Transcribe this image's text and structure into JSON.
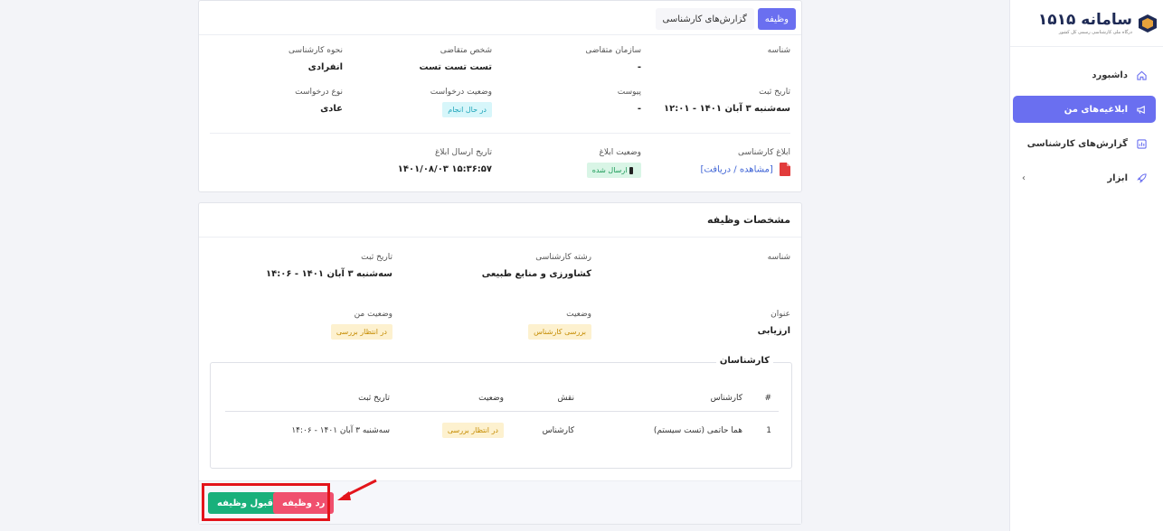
{
  "sidebar": {
    "logo_title": "سامانه ۱۵۱۵",
    "logo_sub": "درگاه ملی کارشناسی رسمی کل کشور",
    "items": [
      {
        "label": "داشبورد"
      },
      {
        "label": "ابلاغیه‌های من"
      },
      {
        "label": "گزارش‌های کارشناسی"
      },
      {
        "label": "ابزار",
        "chevron": "‹"
      }
    ]
  },
  "tabs": [
    {
      "label": "وظیفه"
    },
    {
      "label": "گزارش‌های کارشناسی"
    }
  ],
  "notice": {
    "id_label": "شناسه",
    "org_label": "سازمان متقاضی",
    "org_value": "-",
    "applicant_label": "شخص متقاضی",
    "applicant_value": "تست تست تست",
    "method_label": "نحوه کارشناسی",
    "method_value": "انفرادی",
    "reg_date_label": "تاریخ ثبت",
    "reg_date_value": "سه‌شنبه ۳ آبان ۱۴۰۱ - ۱۲:۰۱",
    "attach_label": "پیوست",
    "attach_value": "-",
    "req_status_label": "وضعیت درخواست",
    "req_status_value": "در حال انجام",
    "req_type_label": "نوع درخواست",
    "req_type_value": "عادی",
    "expert_notice_label": "ابلاغ کارشناسی",
    "expert_notice_link": "[مشاهده / دریافت]",
    "notice_status_label": "وضعیت ابلاغ",
    "notice_status_value": "ارسال شده",
    "send_date_label": "تاریخ ارسال ابلاغ",
    "send_date_value": "۱۴۰۱/۰۸/۰۳ ۱۵:۳۶:۵۷"
  },
  "task": {
    "title": "مشخصات وظیفه",
    "id_label": "شناسه",
    "field_label": "رشته کارشناسی",
    "field_value": "کشاورزی و منابع طبیعی",
    "reg_date_label": "تاریخ ثبت",
    "reg_date_value": "سه‌شنبه ۳ آبان ۱۴۰۱ - ۱۴:۰۶",
    "title_label": "عنوان",
    "title_value": "ارزیابی",
    "status_label": "وضعیت",
    "status_value": "بررسی کارشناس",
    "my_status_label": "وضعیت من",
    "my_status_value": "در انتظار بررسی"
  },
  "experts": {
    "legend": "کارشناسان",
    "headers": {
      "num": "#",
      "expert": "کارشناس",
      "role": "نقش",
      "status": "وضعیت",
      "date": "تاریخ ثبت"
    },
    "rows": [
      {
        "num": "1",
        "expert": "هما حاتمی (تست سیستم)",
        "role": "کارشناس",
        "status": "در انتظار بررسی",
        "date": "سه‌شنبه ۳ آبان ۱۴۰۱ - ۱۴:۰۶"
      }
    ]
  },
  "actions": {
    "accept": "قبول وظیفه",
    "reject": "رد وظیفه"
  },
  "colors": {
    "primary": "#6a6ff0",
    "accept": "#19b07b",
    "reject": "#f0506e",
    "highlight": "#e3141b"
  }
}
